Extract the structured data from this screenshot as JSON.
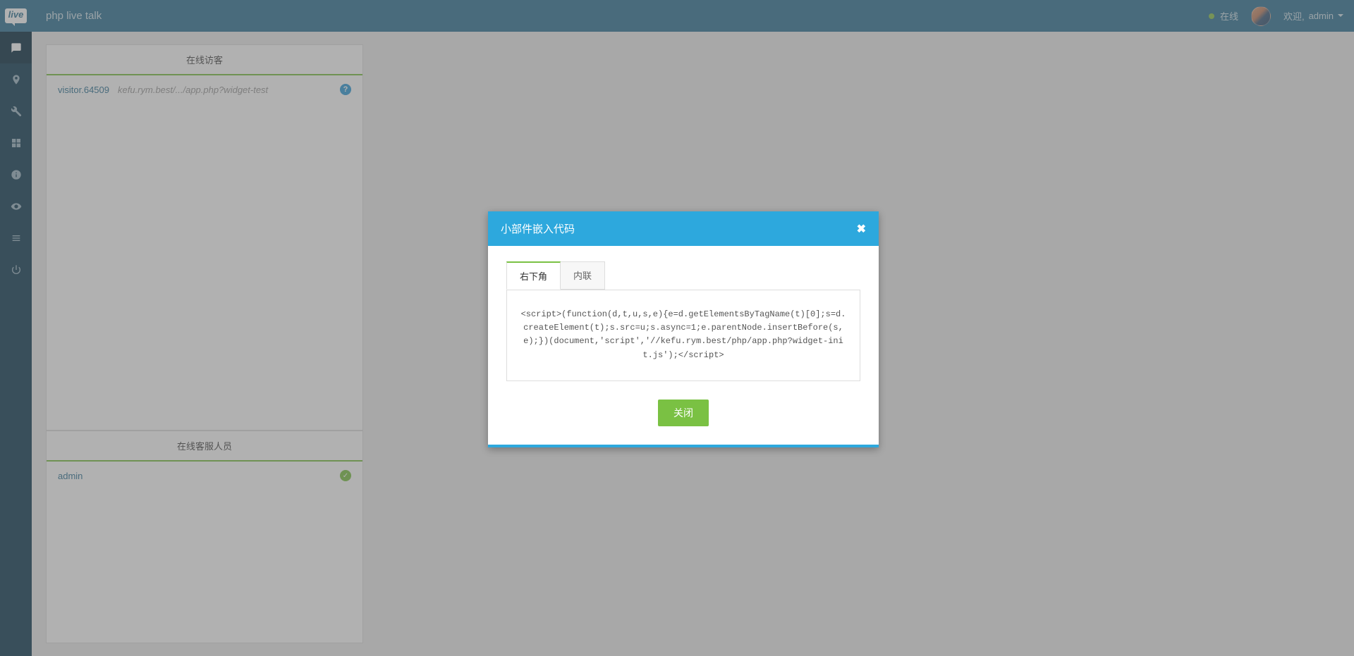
{
  "header": {
    "logo_text": "live",
    "app_title": "php live talk",
    "status_label": "在线",
    "welcome_prefix": "欢迎,",
    "welcome_user": "admin"
  },
  "sidebar": {
    "items": [
      {
        "name": "chat-icon"
      },
      {
        "name": "pin-icon"
      },
      {
        "name": "wrench-icon"
      },
      {
        "name": "grid-icon"
      },
      {
        "name": "info-icon"
      },
      {
        "name": "eye-icon"
      },
      {
        "name": "list-icon"
      },
      {
        "name": "power-icon"
      }
    ]
  },
  "panels": {
    "visitors": {
      "title": "在线访客",
      "rows": [
        {
          "name": "visitor.64509",
          "url": "kefu.rym.best/.../app.php?widget-test"
        }
      ]
    },
    "operators": {
      "title": "在线客服人员",
      "rows": [
        {
          "name": "admin"
        }
      ]
    }
  },
  "modal": {
    "title": "小部件嵌入代码",
    "tabs": [
      {
        "label": "右下角",
        "active": true
      },
      {
        "label": "内联",
        "active": false
      }
    ],
    "code": "<script>(function(d,t,u,s,e){e=d.getElementsByTagName(t)[0];s=d.createElement(t);s.src=u;s.async=1;e.parentNode.insertBefore(s,e);})(document,'script','//kefu.rym.best/php/app.php?widget-init.js');</script>",
    "close_button": "关闭"
  }
}
